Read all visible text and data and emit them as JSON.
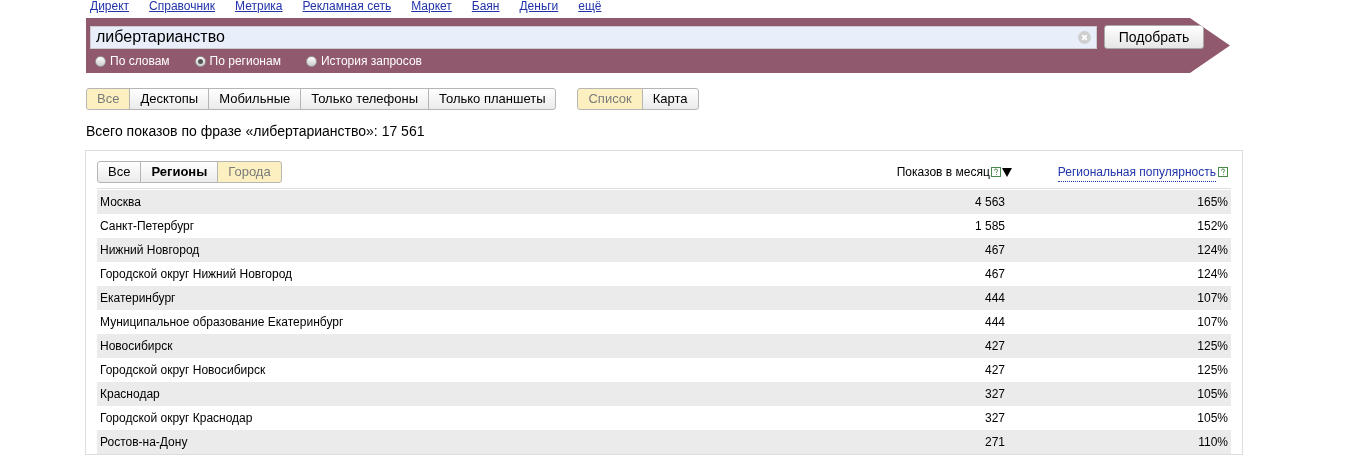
{
  "nav_links": [
    "Директ",
    "Справочник",
    "Метрика",
    "Рекламная сеть",
    "Маркет",
    "Баян",
    "Деньги",
    "ещё"
  ],
  "search": {
    "value": "либертарианство",
    "button": "Подобрать",
    "modes": [
      {
        "label": "По словам",
        "selected": false
      },
      {
        "label": "По регионам",
        "selected": true
      },
      {
        "label": "История запросов",
        "selected": false
      }
    ]
  },
  "device_filters": [
    {
      "label": "Все",
      "selected": true
    },
    {
      "label": "Десктопы",
      "selected": false
    },
    {
      "label": "Мобильные",
      "selected": false
    },
    {
      "label": "Только телефоны",
      "selected": false
    },
    {
      "label": "Только планшеты",
      "selected": false
    }
  ],
  "view_toggle": [
    {
      "label": "Список",
      "selected": true
    },
    {
      "label": "Карта",
      "selected": false
    }
  ],
  "total": "Всего показов по фразе «либертарианство»: 17 561",
  "region_tabs": [
    {
      "label": "Все",
      "selected": false
    },
    {
      "label": "Регионы",
      "selected": false
    },
    {
      "label": "Города",
      "selected": true
    }
  ],
  "table": {
    "columns": [
      "Показов в месяц",
      "Региональная популярность"
    ],
    "rows": [
      {
        "region": "Москва",
        "shows": "4 563",
        "popularity": "165%"
      },
      {
        "region": "Санкт-Петербург",
        "shows": "1 585",
        "popularity": "152%"
      },
      {
        "region": "Нижний Новгород",
        "shows": "467",
        "popularity": "124%"
      },
      {
        "region": "Городской округ Нижний Новгород",
        "shows": "467",
        "popularity": "124%"
      },
      {
        "region": "Екатеринбург",
        "shows": "444",
        "popularity": "107%"
      },
      {
        "region": "Муниципальное образование Екатеринбург",
        "shows": "444",
        "popularity": "107%"
      },
      {
        "region": "Новосибирск",
        "shows": "427",
        "popularity": "125%"
      },
      {
        "region": "Городской округ Новосибирск",
        "shows": "427",
        "popularity": "125%"
      },
      {
        "region": "Краснодар",
        "shows": "327",
        "popularity": "105%"
      },
      {
        "region": "Городской округ Краснодар",
        "shows": "327",
        "popularity": "105%"
      },
      {
        "region": "Ростов-на-Дону",
        "shows": "271",
        "popularity": "110%"
      }
    ]
  }
}
